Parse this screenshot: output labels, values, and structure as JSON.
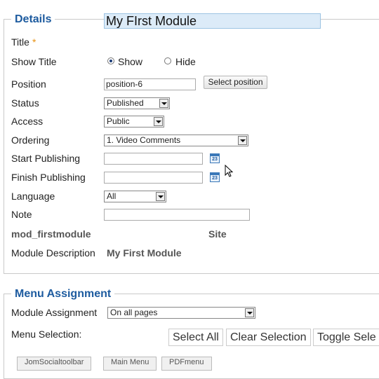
{
  "details": {
    "legend": "Details",
    "title_label": "Title",
    "required_mark": "*",
    "title_value": "My FIrst Module",
    "show_title_label": "Show Title",
    "show_option": "Show",
    "hide_option": "Hide",
    "show_title_selected": "Show",
    "position_label": "Position",
    "position_value": "position-6",
    "select_position_button": "Select position",
    "status_label": "Status",
    "status_value": "Published",
    "access_label": "Access",
    "access_value": "Public",
    "ordering_label": "Ordering",
    "ordering_value": "1. Video Comments",
    "start_publishing_label": "Start Publishing",
    "start_publishing_value": "",
    "finish_publishing_label": "Finish Publishing",
    "finish_publishing_value": "",
    "calendar_icon_text": "23",
    "language_label": "Language",
    "language_value": "All",
    "note_label": "Note",
    "note_value": "",
    "module_name": "mod_firstmodule",
    "client": "Site",
    "module_description_label": "Module Description",
    "module_description_value": "My First Module"
  },
  "menu_assignment": {
    "legend": "Menu Assignment",
    "module_assignment_label": "Module Assignment",
    "module_assignment_value": "On all pages",
    "menu_selection_label": "Menu Selection:",
    "select_all": "Select All",
    "clear_selection": "Clear Selection",
    "toggle_selection": "Toggle Sele",
    "menu_tabs": [
      "JomSocialtoolbar",
      "Main Menu",
      "PDFmenu"
    ]
  },
  "colors": {
    "legend": "#1d5b9f",
    "title_input_bg": "#dcebf8",
    "required": "#e89214"
  }
}
